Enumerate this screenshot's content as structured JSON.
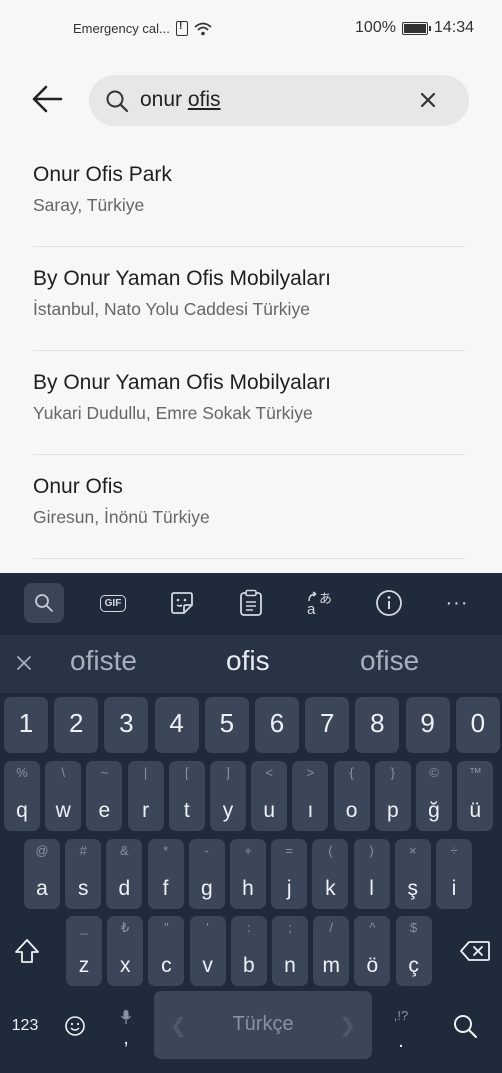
{
  "status_bar": {
    "carrier": "Emergency cal...",
    "battery": "100%",
    "time": "14:34"
  },
  "search": {
    "query_plain": "onur ",
    "query_underlined": "ofis"
  },
  "results": [
    {
      "title": "Onur Ofis Park",
      "subtitle": "Saray, Türkiye"
    },
    {
      "title": "By Onur Yaman Ofis Mobilyaları",
      "subtitle": "İstanbul, Nato Yolu Caddesi Türkiye"
    },
    {
      "title": "By Onur Yaman Ofis Mobilyaları",
      "subtitle": "Yukari Dudullu, Emre Sokak Türkiye"
    },
    {
      "title": "Onur Ofis",
      "subtitle": "Giresun, İnönü Türkiye"
    }
  ],
  "keyboard": {
    "toolbar": {
      "gif": "GIF",
      "more": "···"
    },
    "suggestions": [
      "ofiste",
      "ofis",
      "ofise"
    ],
    "number_row": [
      "1",
      "2",
      "3",
      "4",
      "5",
      "6",
      "7",
      "8",
      "9",
      "0"
    ],
    "row1": [
      {
        "main": "q",
        "sub": "%"
      },
      {
        "main": "w",
        "sub": "\\"
      },
      {
        "main": "e",
        "sub": "~"
      },
      {
        "main": "r",
        "sub": "|"
      },
      {
        "main": "t",
        "sub": "["
      },
      {
        "main": "y",
        "sub": "]"
      },
      {
        "main": "u",
        "sub": "<"
      },
      {
        "main": "ı",
        "sub": ">"
      },
      {
        "main": "o",
        "sub": "{"
      },
      {
        "main": "p",
        "sub": "}"
      },
      {
        "main": "ğ",
        "sub": "©"
      },
      {
        "main": "ü",
        "sub": "™"
      }
    ],
    "row2": [
      {
        "main": "a",
        "sub": "@"
      },
      {
        "main": "s",
        "sub": "#"
      },
      {
        "main": "d",
        "sub": "&"
      },
      {
        "main": "f",
        "sub": "*"
      },
      {
        "main": "g",
        "sub": "-"
      },
      {
        "main": "h",
        "sub": "+"
      },
      {
        "main": "j",
        "sub": "="
      },
      {
        "main": "k",
        "sub": "("
      },
      {
        "main": "l",
        "sub": ")"
      },
      {
        "main": "ş",
        "sub": "×"
      },
      {
        "main": "i",
        "sub": "÷"
      }
    ],
    "row3": [
      {
        "main": "z",
        "sub": "_"
      },
      {
        "main": "x",
        "sub": "₺"
      },
      {
        "main": "c",
        "sub": "\""
      },
      {
        "main": "v",
        "sub": "'"
      },
      {
        "main": "b",
        "sub": ":"
      },
      {
        "main": "n",
        "sub": ";"
      },
      {
        "main": "m",
        "sub": "/"
      },
      {
        "main": "ö",
        "sub": "^"
      },
      {
        "main": "ç",
        "sub": "$"
      }
    ],
    "bottom": {
      "numbers": "123",
      "comma": ",",
      "space": "Türkçe",
      "period": ".",
      "period_sub": ",!?"
    }
  }
}
